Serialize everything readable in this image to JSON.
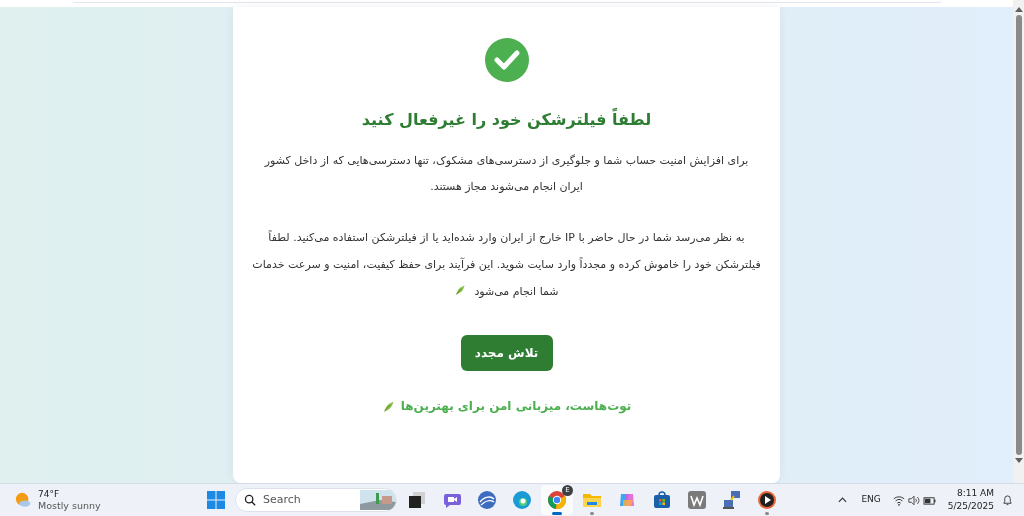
{
  "card": {
    "title": "لطفاً فیلترشکن خود را غیرفعال کنید",
    "paragraphs": [
      "برای افزایش امنیت حساب شما و جلوگیری از دسترسی‌های مشکوک، تنها دسترسی‌هایی که از داخل کشور ایران انجام می‌شوند مجاز هستند.",
      "به نظر می‌رسد شما در حال حاضر با IP خارج از ایران وارد شده‌اید یا از فیلترشکن استفاده می‌کنید. لطفاً فیلترشکن خود را خاموش کرده و مجدداً وارد سایت شوید. این فرآیند برای حفظ کیفیت، امنیت و سرعت خدمات شما انجام می‌شود"
    ],
    "button": "تلاش مجدد",
    "footer": "توت‌هاست، میزبانی امن برای بهترین‌ها"
  },
  "taskbar": {
    "weather": {
      "temperature": "74°F",
      "condition": "Mostly sunny"
    },
    "search": {
      "placeholder": "Search"
    },
    "apps": [
      {
        "kind": "start",
        "selected": false,
        "running": false
      },
      {
        "kind": "taskview",
        "selected": false,
        "running": false
      },
      {
        "kind": "meet",
        "selected": false,
        "running": false
      },
      {
        "kind": "globe",
        "selected": false,
        "running": false
      },
      {
        "kind": "edge",
        "selected": false,
        "running": false
      },
      {
        "kind": "chrome",
        "selected": true,
        "running": true,
        "badge": "E"
      },
      {
        "kind": "folder",
        "selected": false,
        "running": true
      },
      {
        "kind": "copilot",
        "selected": false,
        "running": false
      },
      {
        "kind": "store",
        "selected": false,
        "running": false
      },
      {
        "kind": "wordpress",
        "selected": false,
        "running": false
      },
      {
        "kind": "network",
        "selected": false,
        "running": false
      },
      {
        "kind": "player",
        "selected": false,
        "running": true
      }
    ],
    "language": "ENG",
    "time": "8:11 AM",
    "date": "5/25/2025"
  }
}
